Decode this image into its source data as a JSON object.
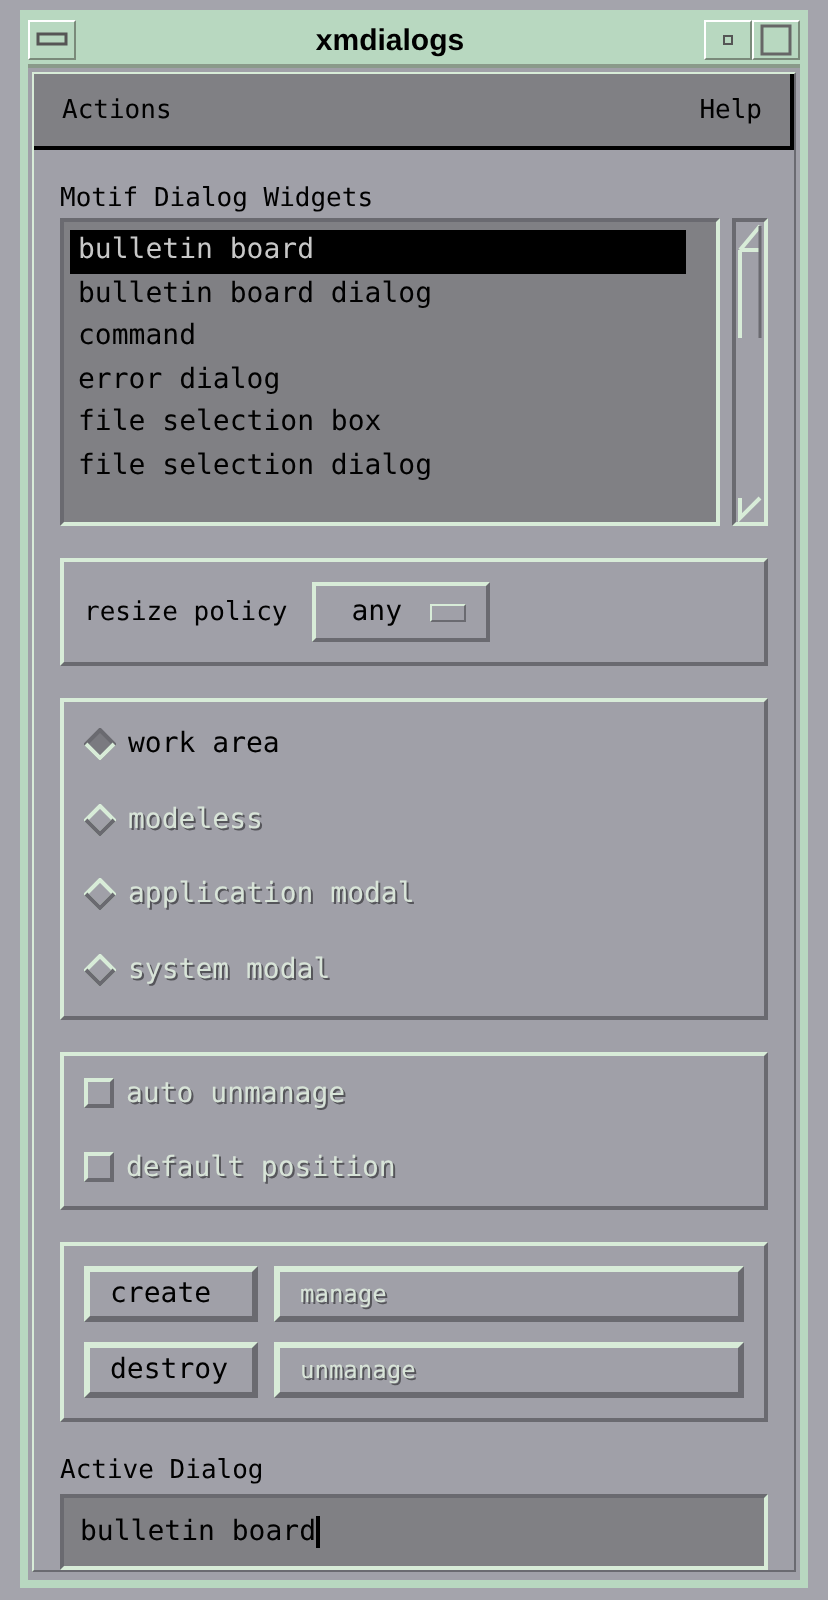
{
  "window": {
    "title": "xmdialogs"
  },
  "menubar": [
    {
      "label": "Actions"
    },
    {
      "label": "Help"
    }
  ],
  "widget_list": {
    "label": "Motif Dialog Widgets",
    "items": [
      {
        "label": "bulletin board",
        "selected": true
      },
      {
        "label": "bulletin board dialog",
        "selected": false
      },
      {
        "label": "command",
        "selected": false
      },
      {
        "label": "error dialog",
        "selected": false
      },
      {
        "label": "file selection box",
        "selected": false
      },
      {
        "label": "file selection dialog",
        "selected": false
      }
    ]
  },
  "resize_policy": {
    "label": "resize policy",
    "value": "any"
  },
  "dialog_style": [
    {
      "label": "work area",
      "selected": true,
      "disabled": false
    },
    {
      "label": "modeless",
      "selected": false,
      "disabled": true
    },
    {
      "label": "application modal",
      "selected": false,
      "disabled": true
    },
    {
      "label": "system modal",
      "selected": false,
      "disabled": true
    }
  ],
  "options": [
    {
      "label": "auto unmanage",
      "checked": false,
      "disabled": true
    },
    {
      "label": "default position",
      "checked": false,
      "disabled": true
    }
  ],
  "buttons": [
    {
      "label": "create",
      "disabled": false
    },
    {
      "label": "manage",
      "disabled": true
    },
    {
      "label": "destroy",
      "disabled": false
    },
    {
      "label": "unmanage",
      "disabled": true
    }
  ],
  "active_dialog": {
    "label": "Active Dialog",
    "value": "bulletin board"
  }
}
